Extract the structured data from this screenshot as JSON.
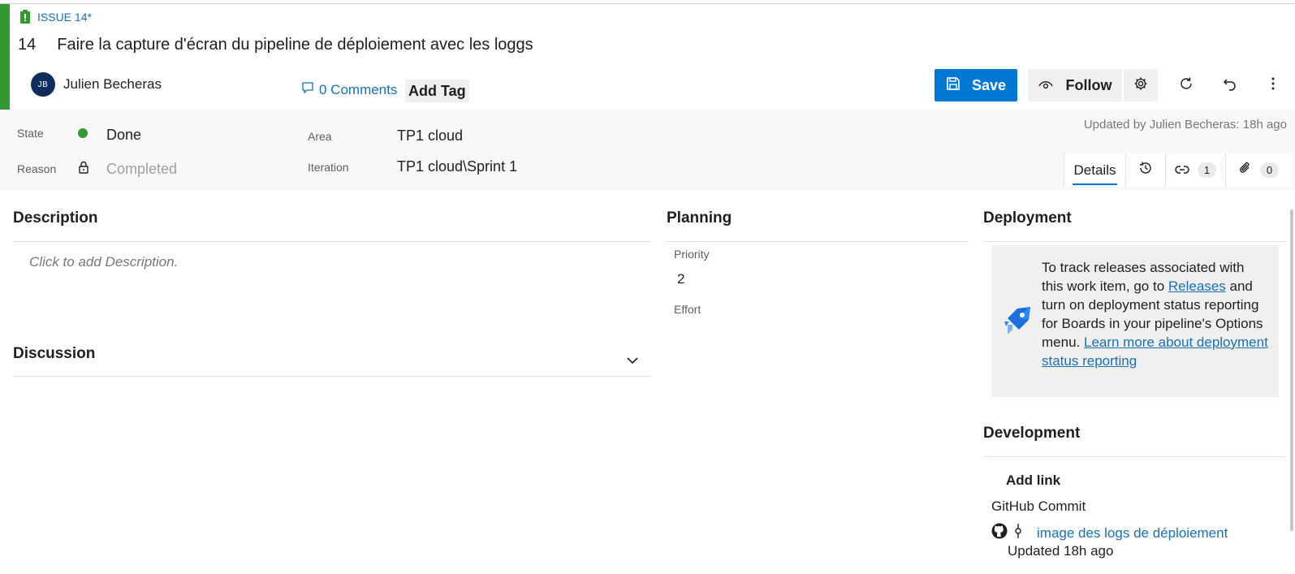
{
  "header": {
    "type_label": "ISSUE 14*",
    "id": "14",
    "title": "Faire la capture d'écran du pipeline de déploiement avec les loggs",
    "assignee_initials": "JB",
    "assignee_name": "Julien Becheras",
    "comments_label": "0 Comments",
    "add_tag_label": "Add Tag"
  },
  "toolbar": {
    "save_label": "Save",
    "follow_label": "Follow",
    "icons": [
      "save-icon",
      "eye-icon",
      "gear-icon",
      "refresh-icon",
      "undo-icon",
      "more-icon"
    ]
  },
  "fields": {
    "state_label": "State",
    "state_value": "Done",
    "reason_label": "Reason",
    "reason_value": "Completed",
    "area_label": "Area",
    "area_value": "TP1 cloud",
    "iteration_label": "Iteration",
    "iteration_value": "TP1 cloud\\Sprint 1",
    "updated_text": "Updated by Julien Becheras: 18h ago"
  },
  "tabs": {
    "details_label": "Details",
    "links_count": "1",
    "attachments_count": "0"
  },
  "description": {
    "heading": "Description",
    "placeholder": "Click to add Description."
  },
  "discussion": {
    "heading": "Discussion"
  },
  "planning": {
    "heading": "Planning",
    "priority_label": "Priority",
    "priority_value": "2",
    "effort_label": "Effort"
  },
  "deployment": {
    "heading": "Deployment",
    "text_1": "To track releases associated with this work item, go to",
    "releases_link": "Releases",
    "text_2": "and turn on deployment status reporting for Boards in your pipeline's Options menu.",
    "learn_link": "Learn more about deployment status reporting"
  },
  "development": {
    "heading": "Development",
    "add_link_label": "Add link",
    "category": "GitHub Commit",
    "commit_title": "image des logs de déploiement",
    "commit_updated": "Updated 18h ago"
  },
  "colors": {
    "accent": "#339933",
    "primary": "#0078d4",
    "link": "#1a6fb5",
    "done": "#339933"
  }
}
